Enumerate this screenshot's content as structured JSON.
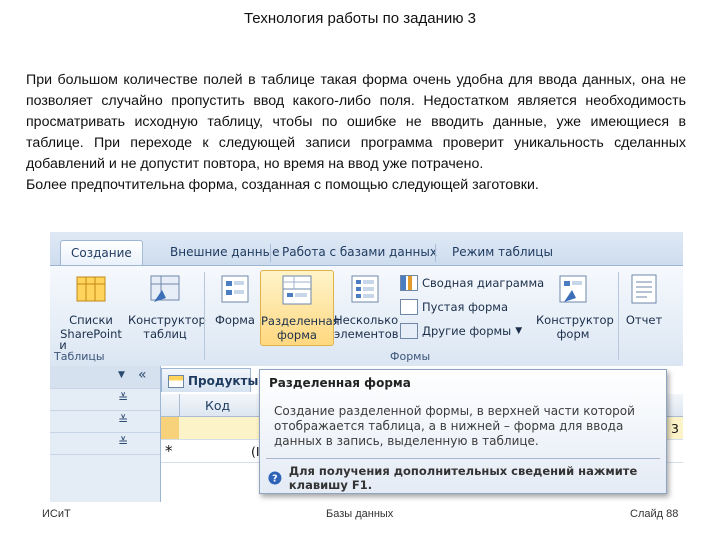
{
  "slide": {
    "title": "Технология работы по заданию 3",
    "paragraph1": "При большом количестве полей в таблице такая форма очень удобна для ввода данных, она не позволяет случайно пропустить ввод какого-либо поля. Недостатком является необходимость просматривать исходную таблицу, чтобы по ошибке не вводить данные, уже имеющиеся в таблице. При переходе к следующей записи программа проверит уникальность сделанных добавлений и не допустит повтора, но время на ввод уже потрачено.",
    "paragraph2": "Более предпочтительна форма, созданная с помощью следующей заготовки.",
    "footer_left": "ИСиТ",
    "footer_center": "Базы данных",
    "footer_right": "Слайд 88"
  },
  "ribbon": {
    "tabs": [
      "Создание",
      "Внешние данные",
      "Работа с базами данных",
      "Режим таблицы"
    ],
    "active_tab_index": 0,
    "buttons": {
      "sharepoint_lists": "Списки SharePoint",
      "table_constructor": "Конструктор таблиц",
      "form": "Форма",
      "split_form": "Разделенная форма",
      "multiple_items": "Несколько элементов",
      "pivot_chart": "Сводная диаграмма",
      "blank_form": "Пустая форма",
      "more_forms": "Другие формы",
      "form_constructor": "Конструктор форм",
      "report": "Отчет"
    },
    "groups": {
      "tables": "Таблицы",
      "forms": "Формы"
    }
  },
  "datasheet": {
    "tab_title": "Продукты",
    "column_header": "Код",
    "new_row_marker": "*",
    "new_row_value": "(I",
    "row_value_right": "3"
  },
  "tooltip": {
    "title": "Разделенная форма",
    "body": "Создание разделенной формы, в верхней части которой отображается таблица, а в нижней – форма для ввода данных в запись, выделенную в таблице.",
    "help": "Для получения дополнительных сведений нажмите клавишу F1."
  },
  "icons": {
    "tab_icon": "table-icon",
    "help_icon": "help-icon"
  },
  "colors": {
    "ribbon_blue": "#dbe6f3",
    "selected_button": "#ffd880",
    "help_icon": "#2e63b8"
  }
}
